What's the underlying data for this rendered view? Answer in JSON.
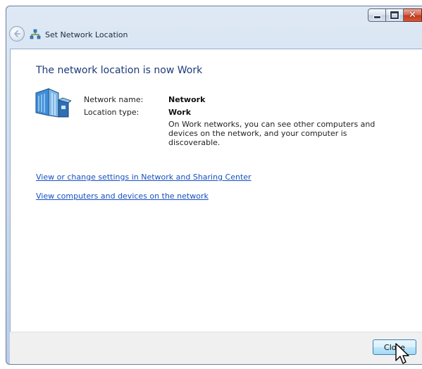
{
  "window": {
    "title": "Set Network Location"
  },
  "main": {
    "heading": "The network location is now Work",
    "network_name_label": "Network name:",
    "network_name_value": "Network",
    "location_type_label": "Location type:",
    "location_type_value": "Work",
    "description": "On Work networks, you can see other computers and devices on the network, and your computer is discoverable.",
    "links": [
      "View or change settings in Network and Sharing Center",
      "View computers and devices on the network"
    ]
  },
  "footer": {
    "close_label": "Close"
  },
  "icons": {
    "back": "back-arrow-icon",
    "title": "network-icon",
    "main": "network-building-icon",
    "minimize": "minimize-icon",
    "maximize": "maximize-icon",
    "close": "close-icon",
    "cursor": "mouse-pointer-icon"
  },
  "colors": {
    "heading": "#1e3a7a",
    "link": "#1550c0",
    "close_caption": "#c23b1c"
  }
}
